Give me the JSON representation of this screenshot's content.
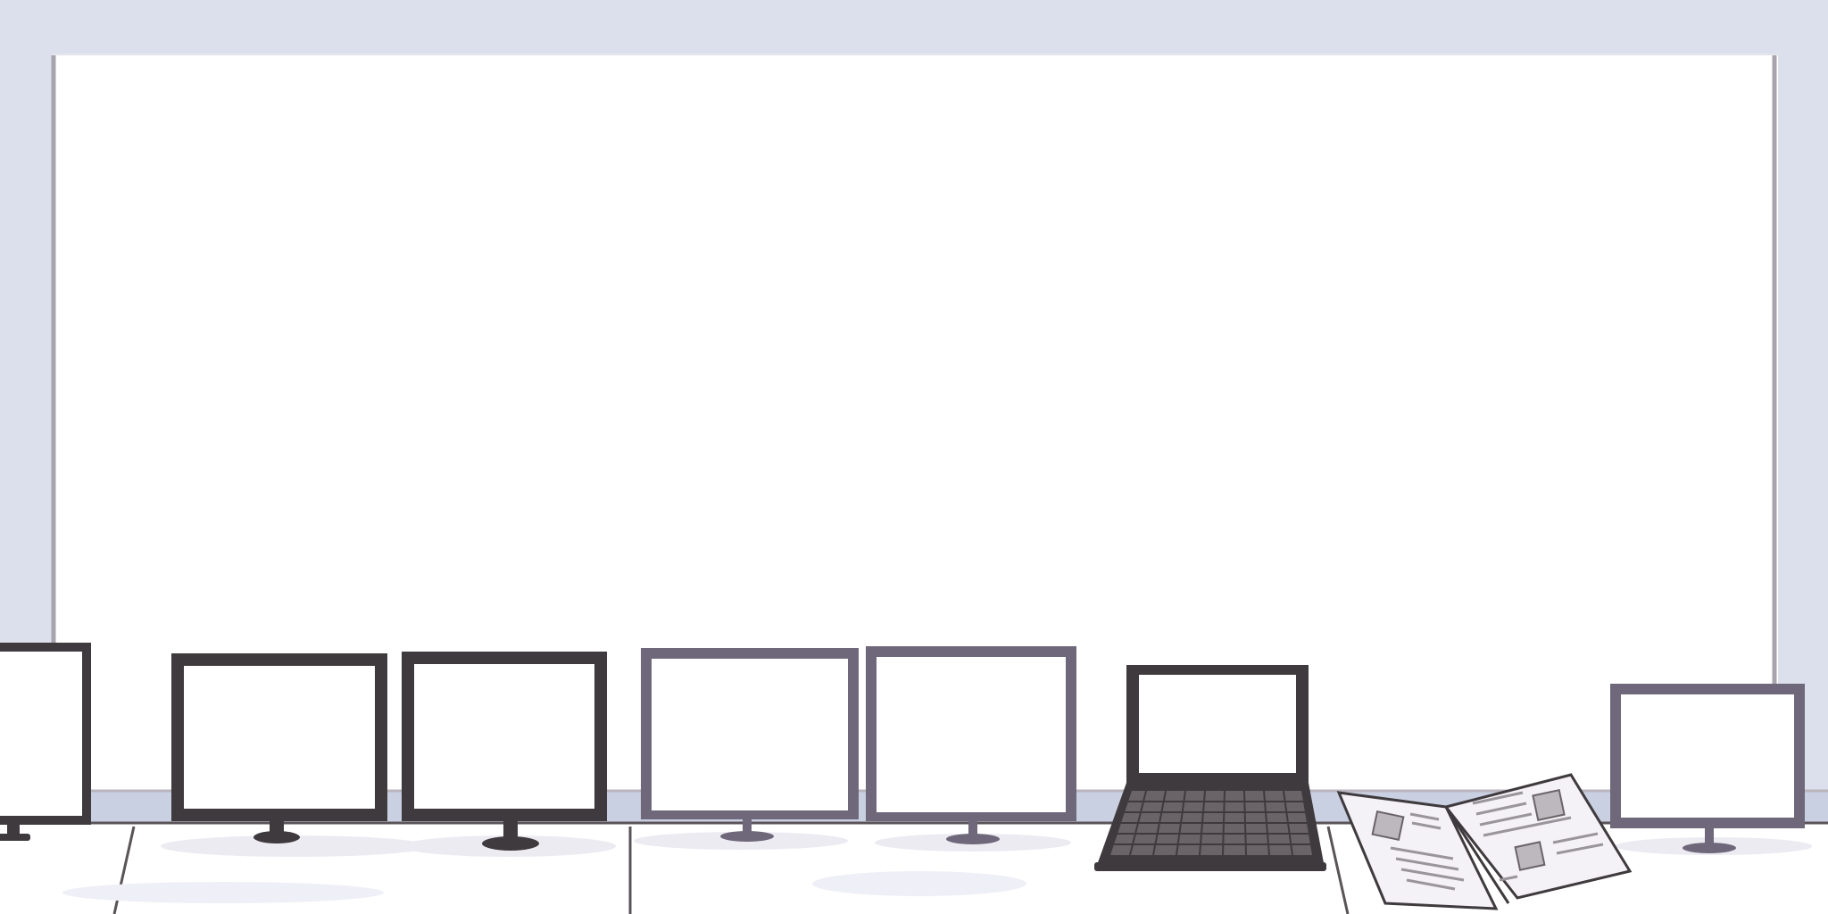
{
  "scene": {
    "colors": {
      "wall": "#dce0ec",
      "whiteboard": "#ffffff",
      "whiteboard_edge": "#a8a4ac",
      "desk": "#ffffff",
      "desk_shadow": "#ecebf2",
      "outline_dark": "#3f3a3d",
      "outline_purple": "#6f687a",
      "screen": "#ffffff",
      "keyboard": "#4a4447"
    },
    "objects": [
      "whiteboard",
      "monitor-1",
      "monitor-2",
      "monitor-3",
      "monitor-4",
      "monitor-5",
      "laptop",
      "open-magazine",
      "monitor-6"
    ]
  }
}
